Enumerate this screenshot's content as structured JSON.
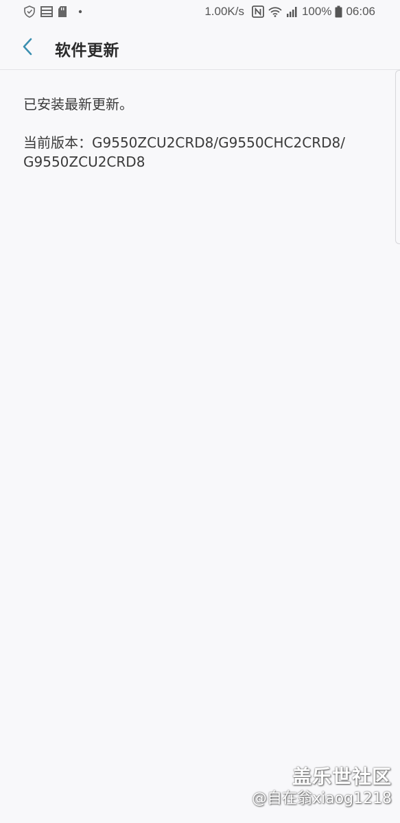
{
  "status_bar": {
    "network_speed": "1.00K/s",
    "battery_percent": "100%",
    "time": "06:06",
    "left_icons": [
      "shield-icon",
      "storage-icon",
      "sd-card-icon",
      "dot-icon"
    ],
    "right_icons": [
      "nfc-icon",
      "wifi-icon",
      "signal-icon",
      "battery-icon"
    ]
  },
  "app_bar": {
    "title": "软件更新",
    "back_icon": "chevron-left-icon",
    "accent_color": "#3b8fb0"
  },
  "content": {
    "status_message": "已安装最新更新。",
    "version_line_1": "当前版本：G9550ZCU2CRD8/G9550CHC2CRD8/",
    "version_line_2": "G9550ZCU2CRD8"
  },
  "watermark": {
    "brand": "盖乐世社区",
    "user": "@自在翁xiaog1218"
  }
}
